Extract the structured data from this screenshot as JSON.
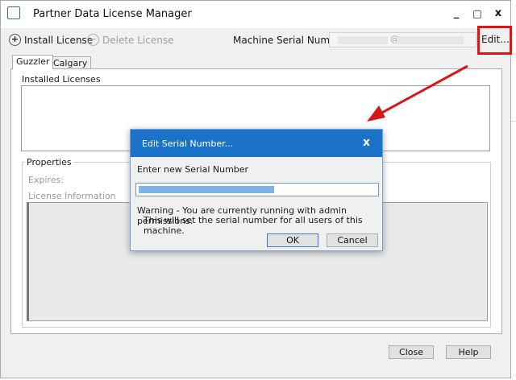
{
  "window": {
    "title": "Partner Data License Manager",
    "controls": {
      "minimize": "_",
      "maximize": "□",
      "close": "x"
    }
  },
  "toolbar": {
    "install_label": "Install License",
    "delete_label": "Delete License",
    "machine_serial_label": "Machine Serial Number",
    "serial_at": "@",
    "edit_label": "Edit..."
  },
  "tabs": [
    {
      "label": "Guzzler",
      "selected": true
    },
    {
      "label": "Calgary",
      "selected": false
    }
  ],
  "main": {
    "installed_label": "Installed Licenses",
    "properties_label": "Properties",
    "expires_label": "Expires:",
    "license_info_label": "License Information",
    "close_label": "Close",
    "help_label": "Help"
  },
  "dialog": {
    "title": "Edit Serial Number...",
    "close_glyph": "x",
    "prompt": "Enter new Serial Number",
    "warning_line1": "Warning - You are currently running with admin permissions.",
    "warning_line2": "This will set the serial number for all users of this machine.",
    "ok_label": "OK",
    "cancel_label": "Cancel"
  },
  "colors": {
    "dialog_titlebar": "#1a73c9",
    "highlight": "#e01414",
    "arrow": "#d41818"
  }
}
